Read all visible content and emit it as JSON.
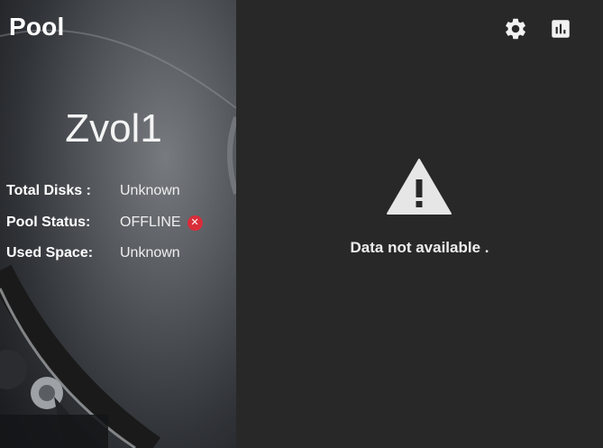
{
  "header": {
    "title": "Pool"
  },
  "pool": {
    "name": "Zvol1",
    "details": [
      {
        "label": "Total Disks :",
        "value": "Unknown"
      },
      {
        "label": "Pool Status:",
        "value": "OFFLINE",
        "status_icon": "error-circle-icon"
      },
      {
        "label": "Used Space:",
        "value": "Unknown"
      }
    ]
  },
  "toolbar": {
    "settings_icon": "gear-icon",
    "reports_icon": "bar-chart-icon"
  },
  "chart_area": {
    "message": "Data not available .",
    "icon": "warning-icon"
  },
  "colors": {
    "panel_bg": "#282828",
    "status_error": "#d92d3a",
    "text": "#eeeeee"
  }
}
